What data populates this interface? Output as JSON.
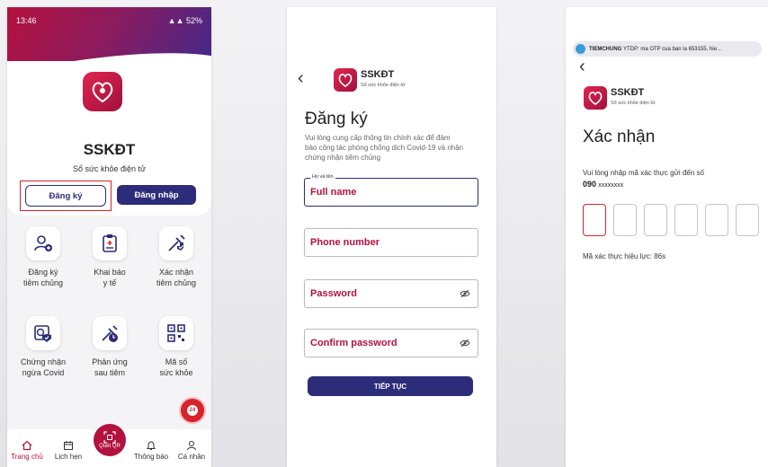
{
  "colors": {
    "brand_red": "#b3123e",
    "navy": "#2c2c7a",
    "highlight": "#d8232a"
  },
  "phone1": {
    "status_time": "13:46",
    "status_battery": "52%",
    "app_title": "SSKĐT",
    "app_subtitle": "Sổ sức khỏe điện tử",
    "register_label": "Đăng ký",
    "login_label": "Đăng nhập",
    "grid": [
      {
        "icon": "user-add-icon",
        "line1": "Đăng ký",
        "line2": "tiêm chủng"
      },
      {
        "icon": "clipboard-icon",
        "line1": "Khai báo",
        "line2": "y tế"
      },
      {
        "icon": "syringe-check-icon",
        "line1": "Xác nhận",
        "line2": "tiêm chủng"
      },
      {
        "icon": "certificate-icon",
        "line1": "Chứng nhận",
        "line2": "ngừa Covid"
      },
      {
        "icon": "reaction-icon",
        "line1": "Phản ứng",
        "line2": "sau tiêm"
      },
      {
        "icon": "qr-code-icon",
        "line1": "Mã số",
        "line2": "sức khỏe"
      }
    ],
    "fab_label": "24",
    "tabs": [
      {
        "icon": "home-icon",
        "label": "Trang chủ"
      },
      {
        "icon": "calendar-icon",
        "label": "Lịch hẹn"
      },
      {
        "icon": "bell-icon",
        "label": "Thông báo"
      },
      {
        "icon": "person-icon",
        "label": "Cá nhân"
      }
    ],
    "qr_label": "Quét QR"
  },
  "phone2": {
    "brand": "SSKĐT",
    "brand_sub": "Sổ sức khỏe điện tử",
    "title": "Đăng ký",
    "description_l1": "Vui lòng cung cấp thông tin chính xác để đảm",
    "description_l2": "bảo công tác phòng chống dịch Covid-19 và nhận",
    "description_l3": "chứng nhận tiêm chủng",
    "field_legend": "Họ và tên",
    "fields": [
      "Full name",
      "Phone number",
      "Password",
      "Confirm password"
    ],
    "continue_label": "TIẾP TỤC"
  },
  "phone3": {
    "notification_sender": "TIEMCHUNG",
    "notification_text": "YTDP: ma OTP cua ban la 653155, hie...",
    "brand": "SSKĐT",
    "brand_sub": "Sổ sức khỏe điện tử",
    "title": "Xác nhận",
    "instruction": "Vui lòng nhập mã xác thực gửi đến số",
    "phone_prefix": "090",
    "phone_masked": "xxxxxxxx",
    "validity": "Mã xác thực hiệu lực: 86s"
  }
}
